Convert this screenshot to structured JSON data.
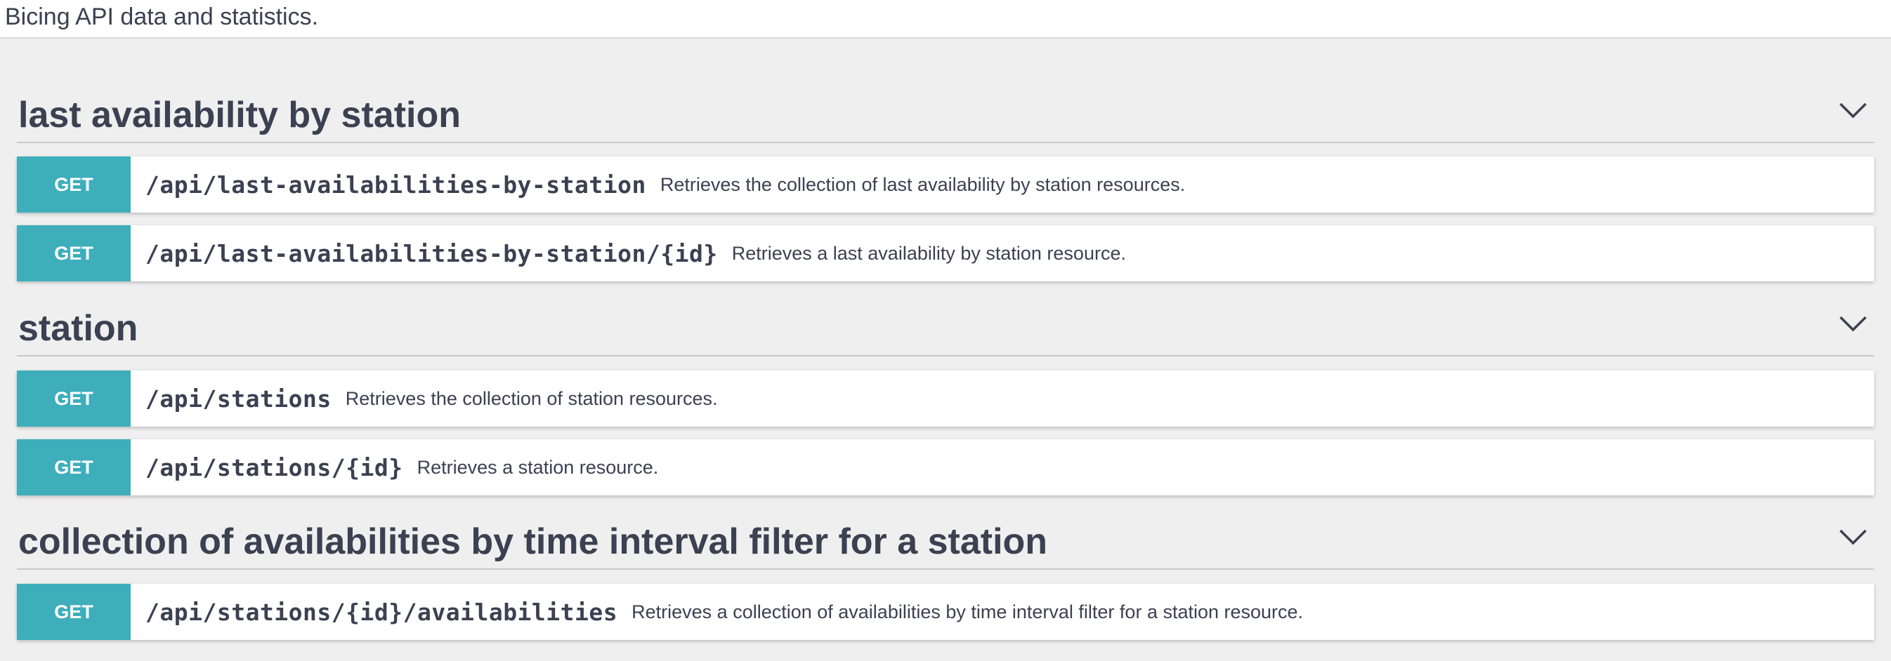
{
  "page": {
    "description": "Bicing API data and statistics."
  },
  "colors": {
    "get_method": "#3eaebb",
    "background": "#efefef",
    "text": "#3b4151"
  },
  "sections": [
    {
      "title": "last availability by station",
      "toggle_icon": "chevron-down-icon",
      "operations": [
        {
          "method": "GET",
          "path": "/api/last-availabilities-by-station",
          "summary": "Retrieves the collection of last availability by station resources."
        },
        {
          "method": "GET",
          "path": "/api/last-availabilities-by-station/{id}",
          "summary": "Retrieves a last availability by station resource."
        }
      ]
    },
    {
      "title": "station",
      "toggle_icon": "chevron-down-icon",
      "operations": [
        {
          "method": "GET",
          "path": "/api/stations",
          "summary": "Retrieves the collection of station resources."
        },
        {
          "method": "GET",
          "path": "/api/stations/{id}",
          "summary": "Retrieves a station resource."
        }
      ]
    },
    {
      "title": "collection of availabilities by time interval filter for a station",
      "toggle_icon": "chevron-down-icon",
      "operations": [
        {
          "method": "GET",
          "path": "/api/stations/{id}/availabilities",
          "summary": "Retrieves a collection of availabilities by time interval filter for a station resource."
        }
      ]
    }
  ]
}
